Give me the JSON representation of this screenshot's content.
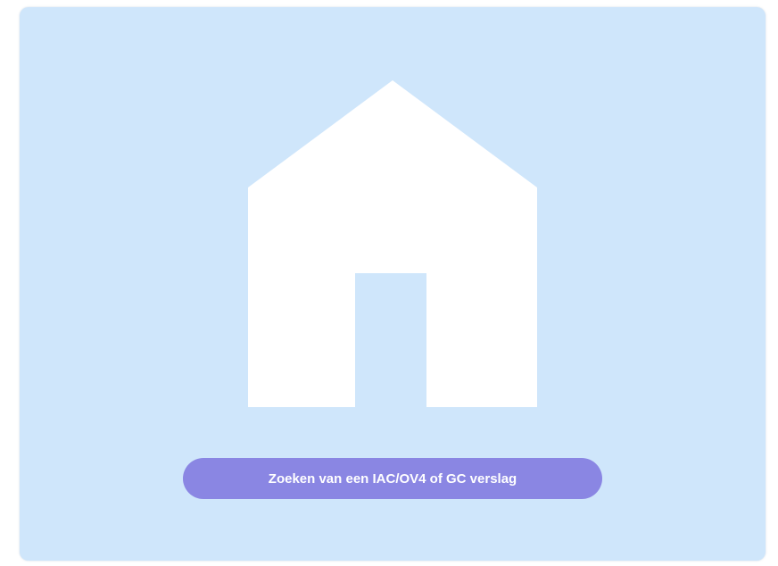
{
  "main": {
    "icon": "house-icon",
    "action_button_label": "Zoeken van een IAC/OV4 of GC verslag"
  },
  "colors": {
    "card_background": "#cfe6fb",
    "icon_fill": "#ffffff",
    "button_background": "#8a86e3",
    "button_text": "#ffffff"
  }
}
